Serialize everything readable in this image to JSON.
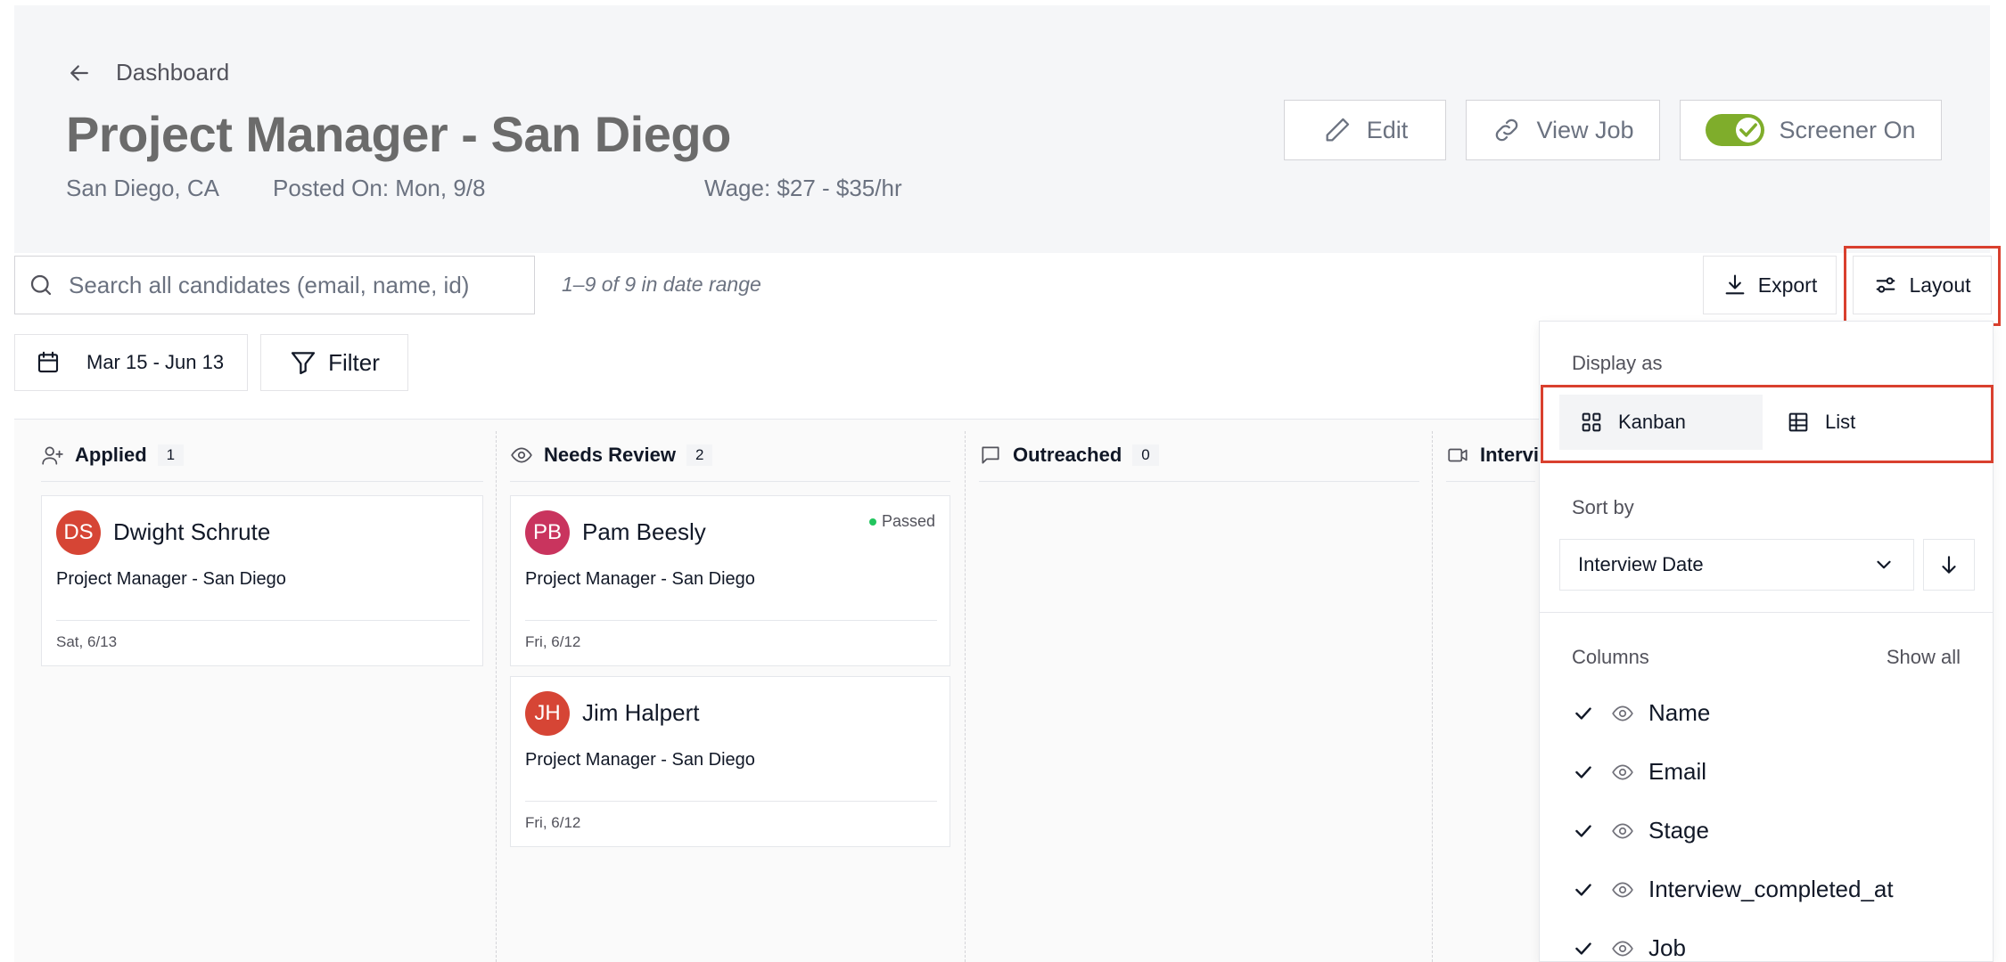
{
  "header": {
    "back_label": "Dashboard",
    "title": "Project Manager - San Diego",
    "location": "San Diego, CA",
    "posted": "Posted On: Mon, 9/8",
    "wage": "Wage: $27 - $35/hr",
    "buttons": {
      "edit": "Edit",
      "view_job": "View Job",
      "screener": "Screener On"
    },
    "screener_on": true
  },
  "toolbar": {
    "search_placeholder": "Search all candidates (email, name, id)",
    "range_text": "1–9 of 9 in date range",
    "export": "Export",
    "layout": "Layout",
    "date_range": "Mar 15 - Jun 13",
    "filter": "Filter"
  },
  "columns": [
    {
      "title": "Applied",
      "count": "1",
      "icon": "user-plus-icon",
      "cards": [
        {
          "initials": "DS",
          "name": "Dwight Schrute",
          "job": "Project Manager - San Diego",
          "date": "Sat, 6/13",
          "color": "#d64535"
        }
      ]
    },
    {
      "title": "Needs Review",
      "count": "2",
      "icon": "eye-icon",
      "cards": [
        {
          "initials": "PB",
          "name": "Pam Beesly",
          "job": "Project Manager - San Diego",
          "date": "Fri, 6/12",
          "color": "#c9345e",
          "badge": "Passed"
        },
        {
          "initials": "JH",
          "name": "Jim Halpert",
          "job": "Project Manager - San Diego",
          "date": "Fri, 6/12",
          "color": "#d64535"
        }
      ]
    },
    {
      "title": "Outreached",
      "count": "0",
      "icon": "message-square-icon",
      "cards": []
    },
    {
      "title": "Intervi",
      "icon": "video-icon",
      "cards": []
    }
  ],
  "layout_panel": {
    "display_as_label": "Display as",
    "kanban": "Kanban",
    "list": "List",
    "selected": "Kanban",
    "sort_by_label": "Sort by",
    "sort_value": "Interview Date",
    "columns_label": "Columns",
    "show_all": "Show all",
    "column_items": [
      "Name",
      "Email",
      "Stage",
      "Interview_completed_at",
      "Job"
    ]
  },
  "colors": {
    "accent_highlight": "#d9402e",
    "toggle_on": "#7fad2b",
    "passed_dot": "#22c55e"
  }
}
